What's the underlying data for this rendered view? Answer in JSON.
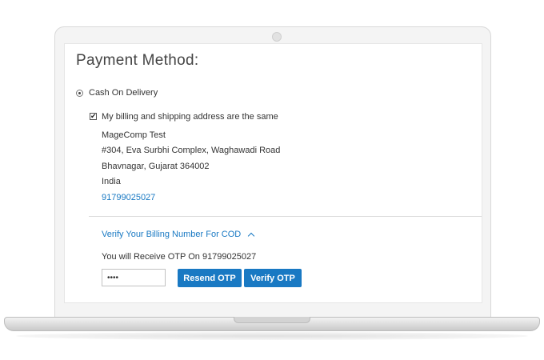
{
  "page": {
    "title": "Payment Method:"
  },
  "payment": {
    "option_label": "Cash On Delivery",
    "same_address_label": "My billing and shipping address are the same",
    "address": {
      "name": "MageComp Test",
      "street": "#304, Eva Surbhi Complex, Waghawadi Road",
      "city_region": "Bhavnagar, Gujarat 364002",
      "country": "India",
      "phone": "91799025027"
    }
  },
  "otp": {
    "toggle_label": "Verify Your Billing Number For COD",
    "info_text": "You will Receive OTP On 91799025027",
    "input_value": "••••",
    "resend_label": "Resend OTP",
    "verify_label": "Verify OTP"
  },
  "colors": {
    "accent": "#1979c3",
    "text": "#333333"
  }
}
